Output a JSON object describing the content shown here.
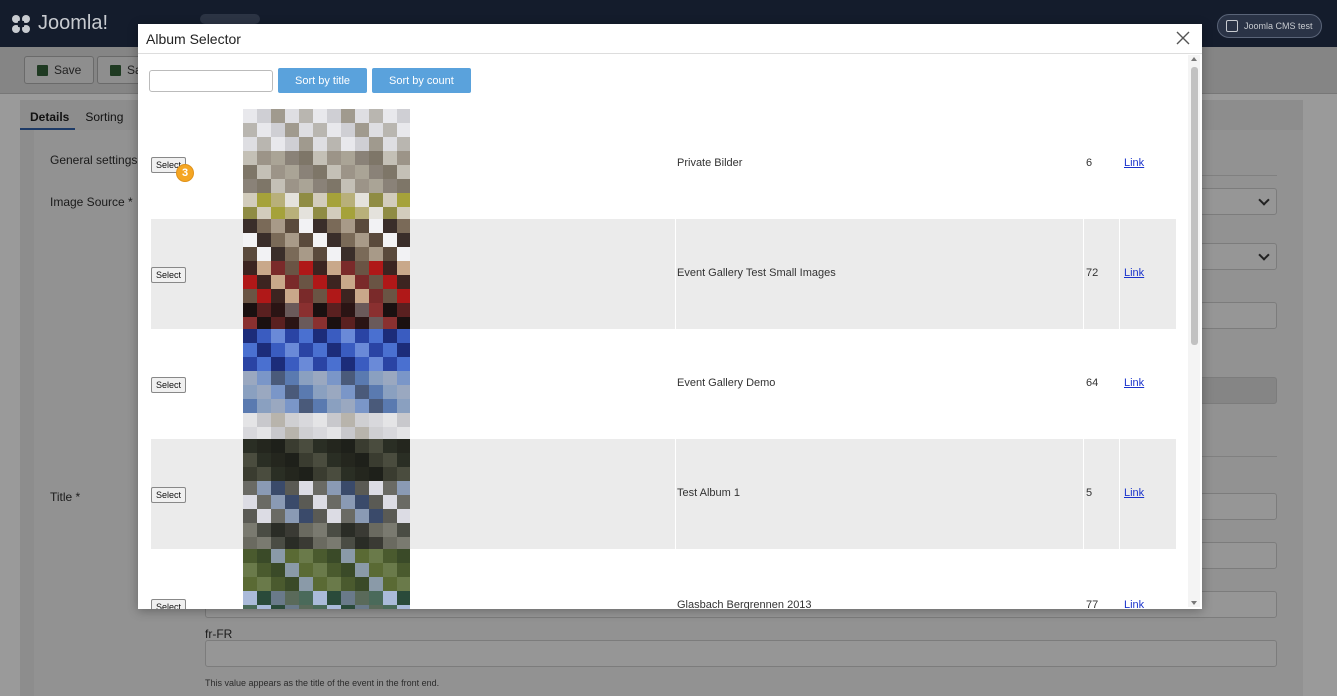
{
  "app": {
    "brand": "Joomla!",
    "site_button": "Joomla CMS test"
  },
  "toolbar": {
    "save_label": "Save",
    "save_close_label": "Sa"
  },
  "tabs": [
    {
      "label": "Details",
      "active": true
    },
    {
      "label": "Sorting",
      "active": false
    }
  ],
  "form": {
    "general_settings": "General settings fo",
    "image_source": "Image Source *",
    "title": "Title *",
    "lang_label": "fr-FR",
    "title_help": "This value appears as the title of the event in the front end."
  },
  "modal": {
    "title": "Album Selector",
    "search": {
      "value": "",
      "placeholder": ""
    },
    "sort_by_title": "Sort by title",
    "sort_by_count": "Sort by count",
    "badge": "3"
  },
  "albums": [
    {
      "select_label": "Select",
      "title": "Private Bilder",
      "count": "6",
      "link_label": "Link"
    },
    {
      "select_label": "Select",
      "title": "Event Gallery Test Small Images",
      "count": "72",
      "link_label": "Link"
    },
    {
      "select_label": "Select",
      "title": "Event Gallery Demo",
      "count": "64",
      "link_label": "Link"
    },
    {
      "select_label": "Select",
      "title": "Test Album 1",
      "count": "5",
      "link_label": "Link"
    },
    {
      "select_label": "Select",
      "title": "Glasbach Bergrennen 2013",
      "count": "77",
      "link_label": "Link"
    }
  ],
  "colors": {
    "header": "#141c2c",
    "sort_button": "#5aa2dc",
    "link": "#1a33cc",
    "badge": "#f5a623"
  }
}
